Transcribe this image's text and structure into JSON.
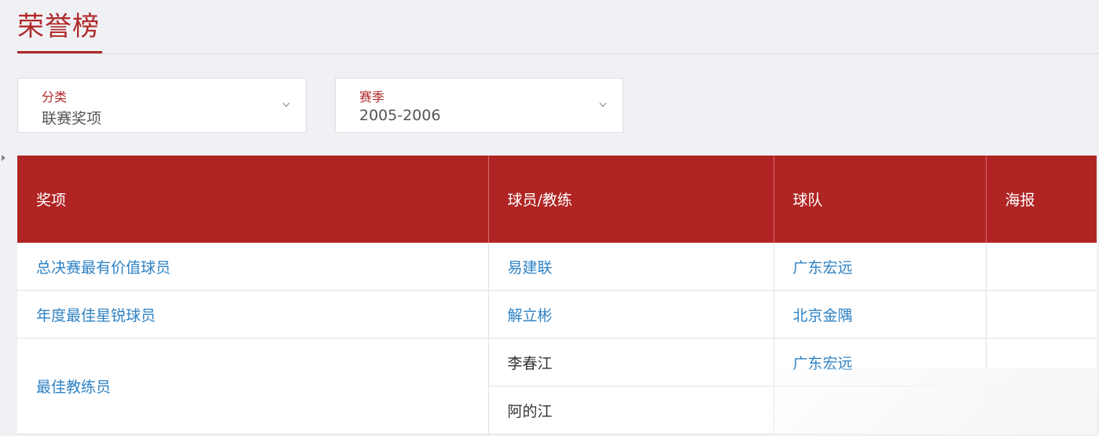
{
  "page": {
    "title": "荣誉榜"
  },
  "filters": {
    "category": {
      "label": "分类",
      "value": "联赛奖项"
    },
    "season": {
      "label": "赛季",
      "value": "2005-2006"
    }
  },
  "table": {
    "headers": [
      "奖项",
      "球员/教练",
      "球队",
      "海报"
    ],
    "rows": [
      {
        "award": "总决赛最有价值球员",
        "person": "易建联",
        "team": "广东宏远",
        "poster": ""
      },
      {
        "award": "年度最佳星锐球员",
        "person": "解立彬",
        "team": "北京金隅",
        "poster": ""
      },
      {
        "award": "最佳教练员",
        "person": "李春江",
        "team": "广东宏远",
        "poster": ""
      },
      {
        "award": "",
        "person": "阿的江",
        "team": "",
        "poster": ""
      }
    ]
  },
  "colors": {
    "accent": "#b02a2a",
    "header_bg": "#b02424",
    "link": "#2f82c4"
  },
  "icons": [
    "chevron-down-icon",
    "expand-arrow-icon"
  ]
}
